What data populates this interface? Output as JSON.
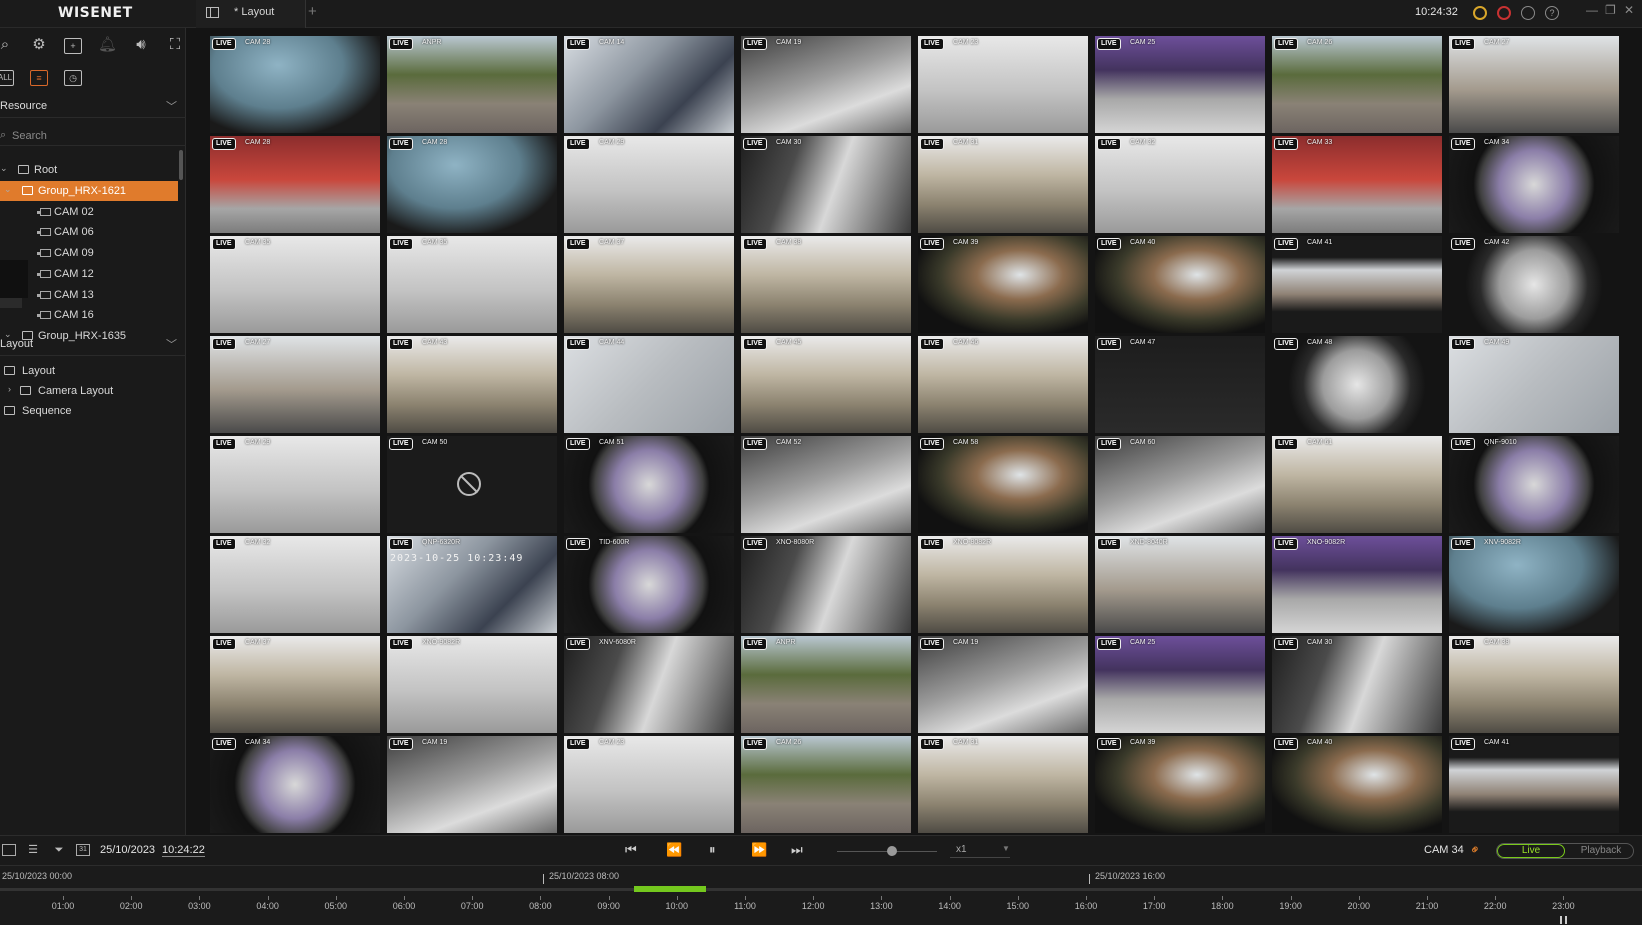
{
  "app": {
    "logo": "WISENET",
    "tab_label": "* Layout",
    "add_tab": "+",
    "clock": "10:24:32"
  },
  "toolbar": {
    "all_label": "ALL"
  },
  "resource": {
    "title": "Resource",
    "search_placeholder": "Search",
    "tree": [
      {
        "label": "Root",
        "level": 0,
        "type": "root"
      },
      {
        "label": "Group_HRX-1621",
        "level": 1,
        "type": "group",
        "selected": true
      },
      {
        "label": "CAM 02",
        "level": 2,
        "type": "camera"
      },
      {
        "label": "CAM 06",
        "level": 2,
        "type": "camera"
      },
      {
        "label": "CAM 09",
        "level": 2,
        "type": "camera"
      },
      {
        "label": "CAM 12",
        "level": 2,
        "type": "camera"
      },
      {
        "label": "CAM 13",
        "level": 2,
        "type": "camera"
      },
      {
        "label": "CAM 16",
        "level": 2,
        "type": "camera"
      },
      {
        "label": "Group_HRX-1635",
        "level": 1,
        "type": "group"
      }
    ]
  },
  "layout_panel": {
    "title": "Layout",
    "items": [
      {
        "label": "Layout",
        "level": 0,
        "icon": "layout-icon"
      },
      {
        "label": "Camera Layout",
        "level": 1,
        "icon": "layout-icon"
      },
      {
        "label": "Sequence",
        "level": 0,
        "icon": "sequence-icon"
      }
    ]
  },
  "live_badge": "LIVE",
  "grid": {
    "columns": 8,
    "tiles": [
      {
        "name": "CAM 28",
        "palette": "fisheye-bus"
      },
      {
        "name": "ANPR",
        "palette": "street"
      },
      {
        "name": "CAM 14",
        "palette": "cables"
      },
      {
        "name": "CAM 19",
        "palette": "desk"
      },
      {
        "name": "CAM 23",
        "palette": "ceiling"
      },
      {
        "name": "CAM 25",
        "palette": "office-purple"
      },
      {
        "name": "CAM 26",
        "palette": "street"
      },
      {
        "name": "CAM 27",
        "palette": "room-bright"
      },
      {
        "name": "CAM 28",
        "palette": "bus-stop"
      },
      {
        "name": "CAM 28",
        "palette": "fisheye-bus"
      },
      {
        "name": "CAM 29",
        "palette": "ceiling"
      },
      {
        "name": "CAM 30",
        "palette": "room-dark"
      },
      {
        "name": "CAM 31",
        "palette": "lab"
      },
      {
        "name": "CAM 32",
        "palette": "ceiling"
      },
      {
        "name": "CAM 33",
        "palette": "bus-stop"
      },
      {
        "name": "CAM 34",
        "palette": "fisheye-room"
      },
      {
        "name": "CAM 35",
        "palette": "ceiling"
      },
      {
        "name": "CAM 35",
        "palette": "ceiling"
      },
      {
        "name": "CAM 37",
        "palette": "lab"
      },
      {
        "name": "CAM 38",
        "palette": "lab"
      },
      {
        "name": "CAM 39",
        "palette": "fisheye-outdoor"
      },
      {
        "name": "CAM 40",
        "palette": "fisheye-outdoor"
      },
      {
        "name": "CAM 41",
        "palette": "window"
      },
      {
        "name": "CAM 42",
        "palette": "fisheye-grey"
      },
      {
        "name": "CAM 27",
        "palette": "room-bright"
      },
      {
        "name": "CAM 43",
        "palette": "lab"
      },
      {
        "name": "CAM 44",
        "palette": "cable-grey"
      },
      {
        "name": "CAM 45",
        "palette": "lab"
      },
      {
        "name": "CAM 46",
        "palette": "lab"
      },
      {
        "name": "CAM 47",
        "palette": "dark"
      },
      {
        "name": "CAM 48",
        "palette": "fisheye-grey"
      },
      {
        "name": "CAM 49",
        "palette": "cable-grey"
      },
      {
        "name": "CAM 29",
        "palette": "ceiling"
      },
      {
        "name": "CAM 50",
        "palette": "no-signal",
        "no_video": true
      },
      {
        "name": "CAM 51",
        "palette": "fisheye-room"
      },
      {
        "name": "CAM 52",
        "palette": "desk"
      },
      {
        "name": "CAM 58",
        "palette": "fisheye-outdoor"
      },
      {
        "name": "CAM 60",
        "palette": "desk"
      },
      {
        "name": "CAM 61",
        "palette": "lab"
      },
      {
        "name": "QNF-9010",
        "palette": "fisheye-room"
      },
      {
        "name": "CAM 32",
        "palette": "ceiling"
      },
      {
        "name": "QNP-6320R",
        "palette": "cables",
        "osd": "2023-10-25 10:23:49"
      },
      {
        "name": "TID-600R",
        "palette": "fisheye-room"
      },
      {
        "name": "XNO-8080R",
        "palette": "room-dark"
      },
      {
        "name": "XNO-8082R",
        "palette": "lab"
      },
      {
        "name": "XND-8040R",
        "palette": "room-bright"
      },
      {
        "name": "XNO-9082R",
        "palette": "office-purple"
      },
      {
        "name": "XNV-9082R",
        "palette": "fisheye-bus"
      },
      {
        "name": "CAM 37",
        "palette": "lab"
      },
      {
        "name": "XNO-9082R",
        "palette": "ceiling"
      },
      {
        "name": "XNV-6080R",
        "palette": "room-dark"
      },
      {
        "name": "ANPR",
        "palette": "street"
      },
      {
        "name": "CAM 19",
        "palette": "desk"
      },
      {
        "name": "CAM 25",
        "palette": "office-purple"
      },
      {
        "name": "CAM 30",
        "palette": "room-dark"
      },
      {
        "name": "CAM 38",
        "palette": "lab"
      },
      {
        "name": "CAM 34",
        "palette": "fisheye-room",
        "selected": true
      },
      {
        "name": "CAM 19",
        "palette": "desk"
      },
      {
        "name": "CAM 23",
        "palette": "ceiling"
      },
      {
        "name": "CAM 26",
        "palette": "street"
      },
      {
        "name": "CAM 31",
        "palette": "lab"
      },
      {
        "name": "CAM 39",
        "palette": "fisheye-outdoor"
      },
      {
        "name": "CAM 40",
        "palette": "fisheye-outdoor"
      },
      {
        "name": "CAM 41",
        "palette": "window"
      }
    ]
  },
  "playback": {
    "date": "25/10/2023",
    "time": "10:24:22",
    "speed": "x1",
    "slider_position": 0.5,
    "selected_camera": "CAM 34",
    "mode_live": "Live",
    "mode_playback": "Playback",
    "active_mode": "Live"
  },
  "timeline": {
    "dates": [
      "25/10/2023 00:00",
      "25/10/2023 08:00",
      "25/10/2023 16:00"
    ],
    "hours": [
      "01:00",
      "02:00",
      "03:00",
      "04:00",
      "05:00",
      "06:00",
      "07:00",
      "08:00",
      "09:00",
      "10:00",
      "11:00",
      "12:00",
      "13:00",
      "14:00",
      "15:00",
      "16:00",
      "17:00",
      "18:00",
      "19:00",
      "20:00",
      "21:00",
      "22:00",
      "23:00"
    ],
    "recorded_range": [
      "09:24",
      "10:30"
    ]
  },
  "colors": {
    "accent": "#e07b2c",
    "live_green": "#7acb1a",
    "alert_red": "#c83232",
    "settings_gold": "#d8a62a"
  }
}
